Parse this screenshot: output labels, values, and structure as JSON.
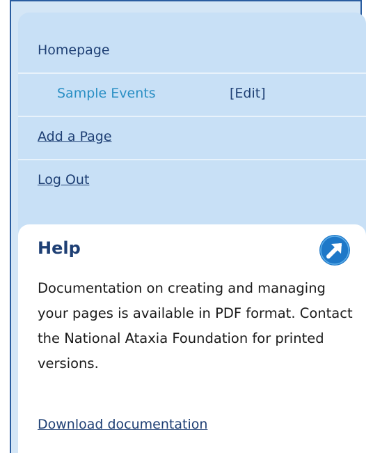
{
  "nav": {
    "homepage": "Homepage",
    "sample_events": "Sample Events",
    "edit": "[Edit]",
    "add_page": "Add a Page",
    "log_out": "Log Out"
  },
  "help": {
    "title": "Help",
    "icon": "arrow-up-right-icon",
    "body": "Documentation on creating and managing your pages is available in PDF format. Contact the National Ataxia Foundation for printed versions.",
    "link": "Download documentation"
  },
  "colors": {
    "panel_bg": "#c8e0f6",
    "frame_border": "#2a5da0",
    "nav_text": "#1e3f74",
    "sub_item_text": "#2a8fc4",
    "help_icon": "#1e78c8"
  }
}
